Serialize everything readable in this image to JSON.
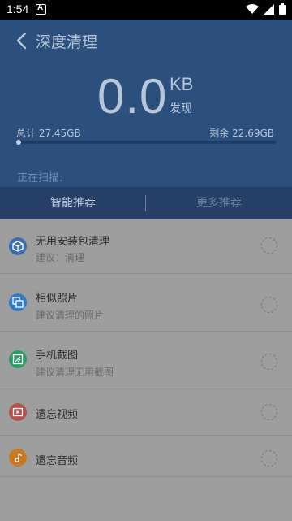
{
  "status": {
    "time": "1:54"
  },
  "header": {
    "title": "深度清理"
  },
  "summary": {
    "size_value": "0.0",
    "size_unit": "KB",
    "found_label": "发现",
    "total_label": "总计 27.45GB",
    "remaining_label": "剩余 22.69GB",
    "usage_fraction": 0.0,
    "scanning_label": "正在扫描:"
  },
  "tabs": [
    {
      "label": "智能推荐",
      "active": true
    },
    {
      "label": "更多推荐",
      "active": false
    }
  ],
  "items": [
    {
      "title": "无用安装包清理",
      "subtitle": "建议：清理",
      "icon": "package-icon",
      "color": "#3c6db0"
    },
    {
      "title": "相似照片",
      "subtitle": "建议清理的照片",
      "icon": "photos-icon",
      "color": "#2f7ac6"
    },
    {
      "title": "手机截图",
      "subtitle": "建议清理无用截图",
      "icon": "screenshot-icon",
      "color": "#2f9a66"
    },
    {
      "title": "遗忘视频",
      "subtitle": "",
      "icon": "video-icon",
      "color": "#b2554f"
    },
    {
      "title": "遗忘音频",
      "subtitle": "",
      "icon": "audio-icon",
      "color": "#c77a23"
    }
  ]
}
